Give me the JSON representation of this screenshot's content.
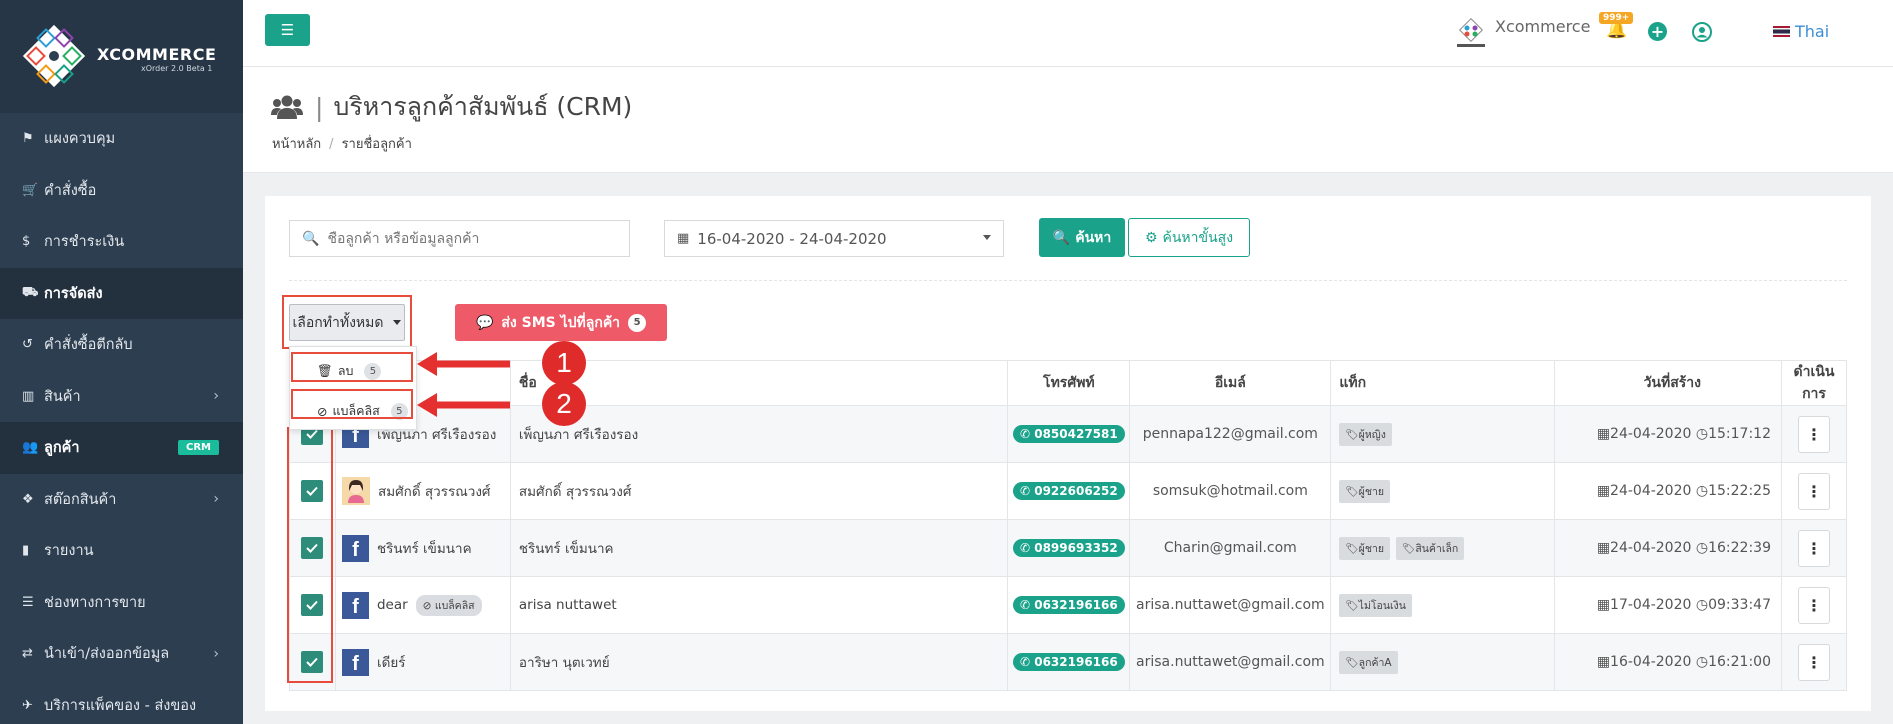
{
  "brand": {
    "name": "XCOMMERCE",
    "version": "xOrder 2.0 Beta 1"
  },
  "sidebar": {
    "items": [
      {
        "label": "แผงควบคุม",
        "icon": "flag-icon"
      },
      {
        "label": "คำสั่งซื้อ",
        "icon": "cart-icon"
      },
      {
        "label": "การชำระเงิน",
        "icon": "dollar-icon"
      },
      {
        "label": "การจัดส่ง",
        "icon": "truck-icon"
      },
      {
        "label": "คำสั่งซื้อตีกลับ",
        "icon": "undo-icon"
      },
      {
        "label": "สินค้า",
        "icon": "barcode-icon"
      },
      {
        "label": "ลูกค้า",
        "icon": "users-icon",
        "badge": "CRM"
      },
      {
        "label": "สต๊อกสินค้า",
        "icon": "cubes-icon"
      },
      {
        "label": "รายงาน",
        "icon": "bar-chart-icon"
      },
      {
        "label": "ช่องทางการขาย",
        "icon": "list-icon"
      },
      {
        "label": "นำเข้า/ส่งออกข้อมูล",
        "icon": "exchange-icon"
      },
      {
        "label": "บริการแพ็คของ - ส่งของ",
        "icon": "paper-plane-icon"
      }
    ]
  },
  "topbar": {
    "shop_name": "Xcommerce",
    "notif_count": "999+",
    "language": "Thai"
  },
  "page": {
    "title": "บริหารลูกค้าสัมพันธ์ (CRM)",
    "breadcrumb": [
      "หน้าหลัก",
      "รายชื่อลูกค้า"
    ]
  },
  "filters": {
    "search_placeholder": "ชื่อลูกค้า หรือข้อมูลลูกค้า",
    "date_range": "16-04-2020 - 24-04-2020",
    "search_button": "ค้นหา",
    "advanced_button": "ค้นหาขั้นสูง"
  },
  "bulk": {
    "label": "เลือกทำทั้งหมด",
    "sms_label": "ส่ง SMS ไปที่ลูกค้า",
    "sms_count": "5",
    "menu": [
      {
        "label": "ลบ",
        "count": "5"
      },
      {
        "label": "แบล็คลิส",
        "count": "5"
      }
    ]
  },
  "callouts": [
    "1",
    "2"
  ],
  "table": {
    "headers": [
      "ชื่อ",
      "โทรศัพท์",
      "อีเมล์",
      "แท็ก",
      "วันที่สร้าง",
      "ดำเนินการ"
    ],
    "rows": [
      {
        "user": "เพ็ญนภา ศรีเรืองรอง",
        "source": "facebook",
        "name": "เพ็ญนภา ศรีเรืองรอง",
        "phone": "0850427581",
        "email": "pennapa122@gmail.com",
        "tags": [
          "ผู้หญิง"
        ],
        "date": "24-04-2020",
        "time": "15:17:12"
      },
      {
        "user": "สมศักดิ์ สุวรรณวงศ์",
        "source": "avatar",
        "name": "สมศักดิ์ สุวรรณวงศ์",
        "phone": "0922606252",
        "email": "somsuk@hotmail.com",
        "tags": [
          "ผู้ชาย"
        ],
        "date": "24-04-2020",
        "time": "15:22:25"
      },
      {
        "user": "ชรินทร์ เข็มนาค",
        "source": "facebook",
        "name": "ชรินทร์ เข็มนาค",
        "phone": "0899693352",
        "email": "Charin@gmail.com",
        "tags": [
          "ผู้ชาย",
          "สินค้าเล็ก"
        ],
        "date": "24-04-2020",
        "time": "16:22:39"
      },
      {
        "user": "dear",
        "source": "facebook",
        "blacklist_label": "แบล็คลิส",
        "name": "arisa nuttawet",
        "phone": "0632196166",
        "email": "arisa.nuttawet@gmail.com",
        "tags": [
          "ไม่โอนเงิน"
        ],
        "date": "17-04-2020",
        "time": "09:33:47"
      },
      {
        "user": "เดียร์",
        "source": "facebook",
        "name": "อาริษา นุตเวทย์",
        "phone": "0632196166",
        "email": "arisa.nuttawet@gmail.com",
        "tags": [
          "ลูกค้าA"
        ],
        "date": "16-04-2020",
        "time": "16:21:00"
      }
    ]
  },
  "colors": {
    "accent": "#1aa38a",
    "sidebar": "#2c3e50",
    "annotation": "#e74c3c",
    "sms": "#ee5a68"
  }
}
